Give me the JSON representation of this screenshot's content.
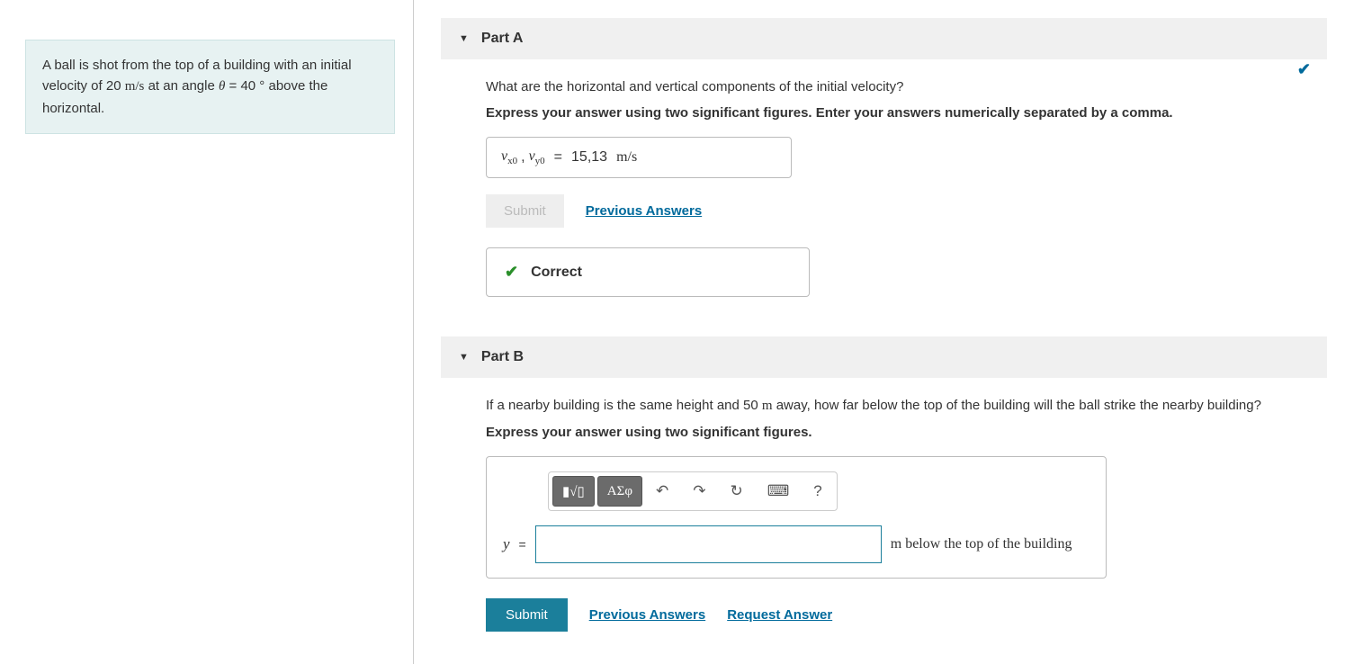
{
  "problem": {
    "text_before_velocity": "A ball is shot from the top of a building with an initial velocity of 20 ",
    "velocity_unit": "m/s",
    "text_mid": " at an angle ",
    "theta": "θ",
    "angle_eq": " = 40",
    "degree": " °",
    "text_after": " above the horizontal."
  },
  "partA": {
    "title": "Part A",
    "question": "What are the horizontal and vertical components of the initial velocity?",
    "instruction": "Express your answer using two significant figures. Enter your answers numerically separated by a comma.",
    "var_label_1": "v",
    "sub_1": "x0",
    "comma": ", ",
    "var_label_2": "v",
    "sub_2": "y0",
    "equals": " = ",
    "value": "15,13",
    "unit": "m/s",
    "submit_label": "Submit",
    "prev_answers": "Previous Answers",
    "correct_label": "Correct"
  },
  "partB": {
    "title": "Part B",
    "question_before": "If a nearby building is the same height and 50 ",
    "question_unit": "m",
    "question_after": " away, how far below the top of the building will the ball strike the nearby building?",
    "instruction": "Express your answer using two significant figures.",
    "toolbar": {
      "template": "▮√▯",
      "symbols": "ΑΣφ",
      "undo": "↶",
      "redo": "↷",
      "reset": "↻",
      "keyboard": "⌨",
      "help": "?"
    },
    "ylabel": "y",
    "equals": " = ",
    "value": "",
    "unit_prefix": "m",
    "unit_suffix": " below the top of the building",
    "submit_label": "Submit",
    "prev_answers": "Previous Answers",
    "request_answer": "Request Answer"
  }
}
